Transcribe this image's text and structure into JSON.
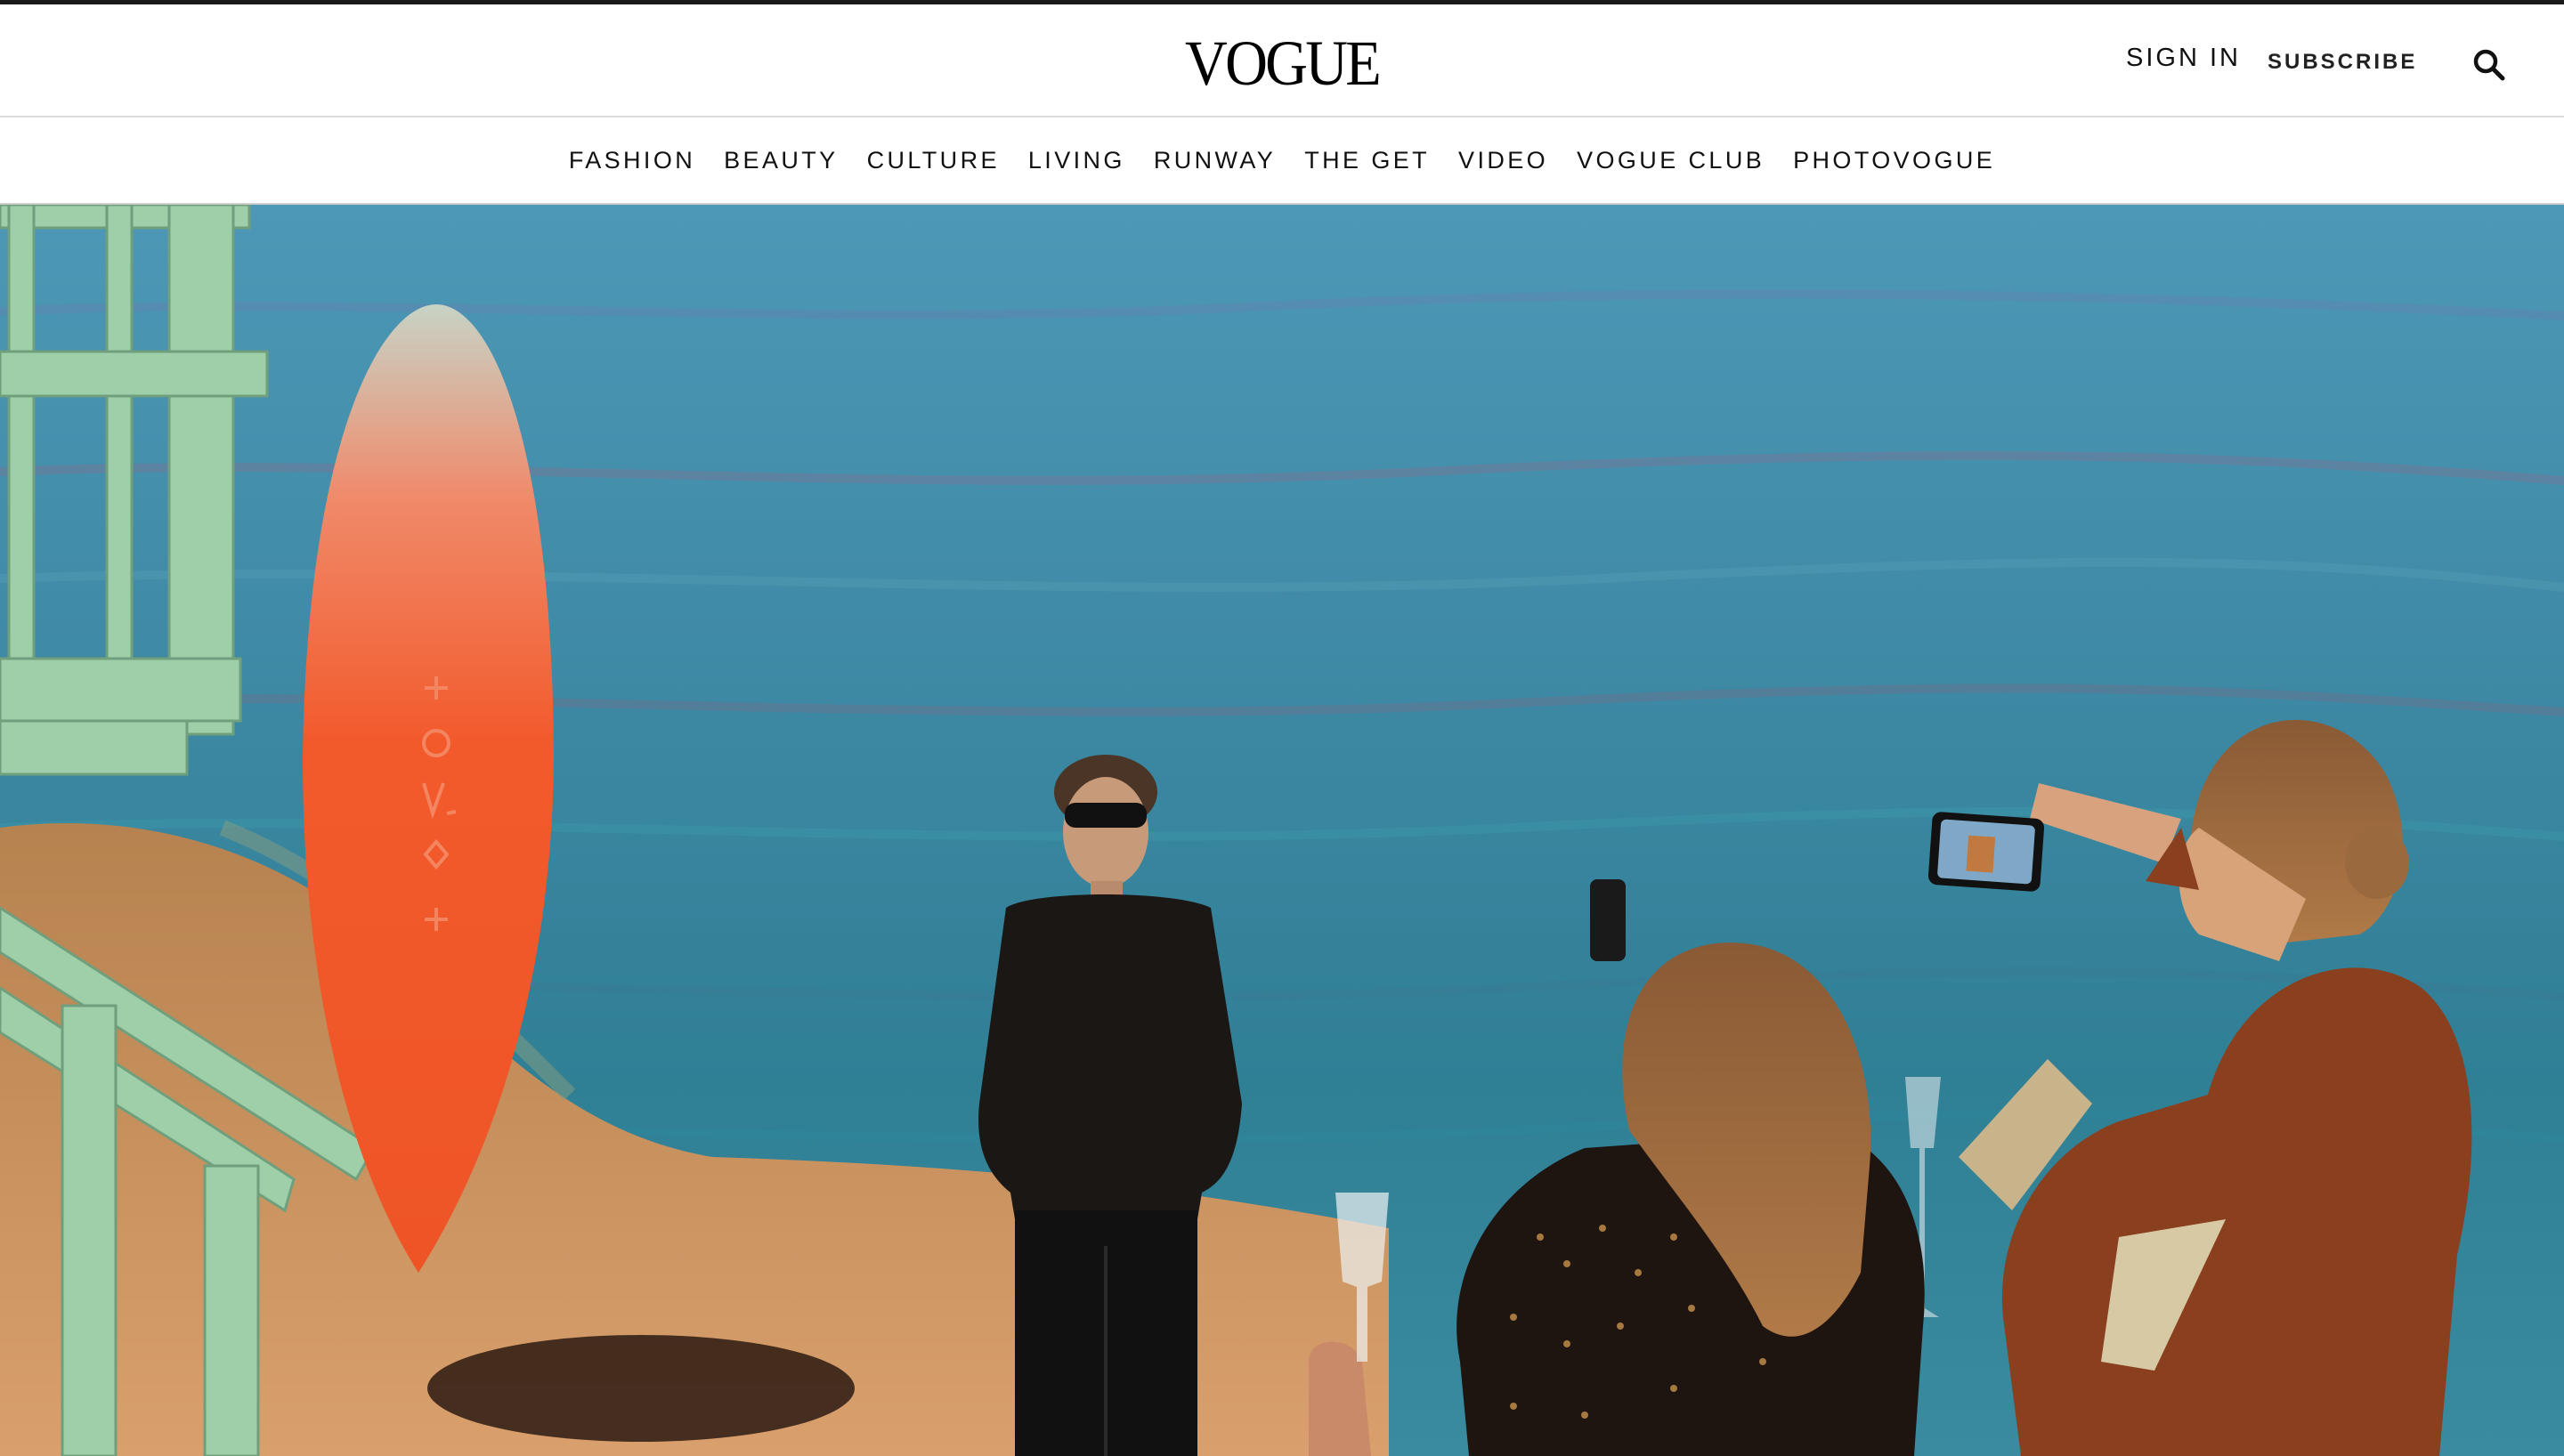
{
  "header": {
    "logo": "VOGUE",
    "sign_in": "SIGN IN",
    "subscribe": "SUBSCRIBE",
    "search_icon": "search-icon"
  },
  "nav": {
    "items": [
      "FASHION",
      "BEAUTY",
      "CULTURE",
      "LIVING",
      "RUNWAY",
      "THE GET",
      "VIDEO",
      "VOGUE CLUB",
      "PHOTOVOGUE"
    ]
  },
  "hero": {
    "scene": "event photo: man in sunglasses posing before an ocean backdrop beside an orange surfboard and a mint lifeguard tower, two women photographing him with phones"
  },
  "colors": {
    "brand_black": "#000000",
    "divider": "#dcdcdc",
    "ocean": "#3f8fa6",
    "surfboard": "#f05a2a",
    "tower": "#9fcfa8",
    "sand": "#c98c5a"
  }
}
